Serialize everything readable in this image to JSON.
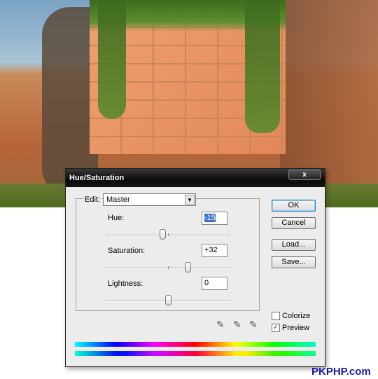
{
  "dialog": {
    "title": "Hue/Saturation",
    "close": "x"
  },
  "edit": {
    "label": "Edit:",
    "value": "Master"
  },
  "hue": {
    "label": "Hue:",
    "value": "-15",
    "min": -180,
    "max": 180,
    "level": -15
  },
  "saturation": {
    "label": "Saturation:",
    "value": "+32",
    "min": -100,
    "max": 100,
    "level": 32
  },
  "lightness": {
    "label": "Lightness:",
    "value": "0",
    "min": -100,
    "max": 100,
    "level": 0
  },
  "buttons": {
    "ok": "OK",
    "cancel": "Cancel",
    "load": "Load...",
    "save": "Save..."
  },
  "checkboxes": {
    "colorize": {
      "label": "Colorize",
      "checked": false
    },
    "preview": {
      "label": "Preview",
      "checked": true
    }
  },
  "icons": [
    "eyedropper-icon",
    "eyedropper-plus-icon",
    "eyedropper-minus-icon"
  ],
  "watermark": "PKPHP.com"
}
